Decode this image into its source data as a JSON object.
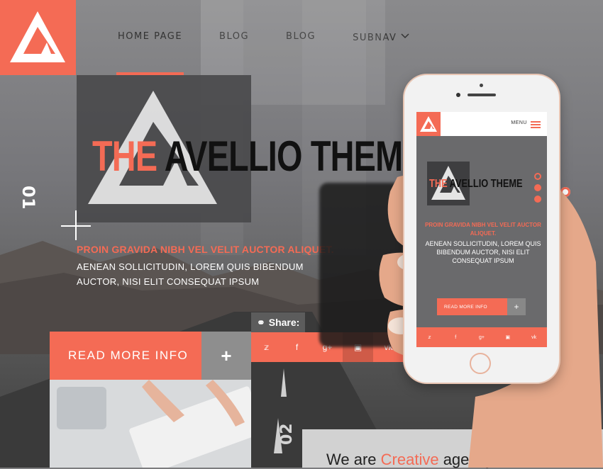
{
  "nav": {
    "items": [
      "HOME PAGE",
      "BLOG",
      "BLOG",
      "SUBNAV"
    ]
  },
  "hero": {
    "title_the": "THE",
    "title_rest": "AVELLIO THEME",
    "section_num": "01",
    "subheading": "PROIN GRAVIDA NIBH VEL VELIT AUCTOR ALIQUET.",
    "body": "AENEAN SOLLICITUDIN, LOREM QUIS BIBENDUM AUCTOR, NISI ELIT CONSEQUAT IPSUM"
  },
  "share": {
    "label": "Share:"
  },
  "read_more": {
    "label": "READ MORE INFO",
    "plus": "+"
  },
  "section2": {
    "num": "02",
    "prefix": "We are",
    "highlight": "Creative",
    "suffix": "agency"
  },
  "phone": {
    "menu_label": "MENU",
    "title_the": "THE",
    "title_rest": "AVELLIO THEME",
    "subheading": "PROIN GRAVIDA NIBH VEL VELIT AUCTOR ALIQUET.",
    "body": "AENEAN SOLLICITUDIN, LOREM QUIS BIBENDUM AUCTOR, NISI ELIT CONSEQUAT IPSUM",
    "read_more": "READ MORE INFO",
    "plus": "+"
  },
  "social_icons": [
    "twitter-icon",
    "facebook-icon",
    "google-plus-icon",
    "instagram-icon",
    "vk-icon"
  ],
  "colors": {
    "accent": "#f46b55",
    "dark": "#4a4a4c"
  }
}
